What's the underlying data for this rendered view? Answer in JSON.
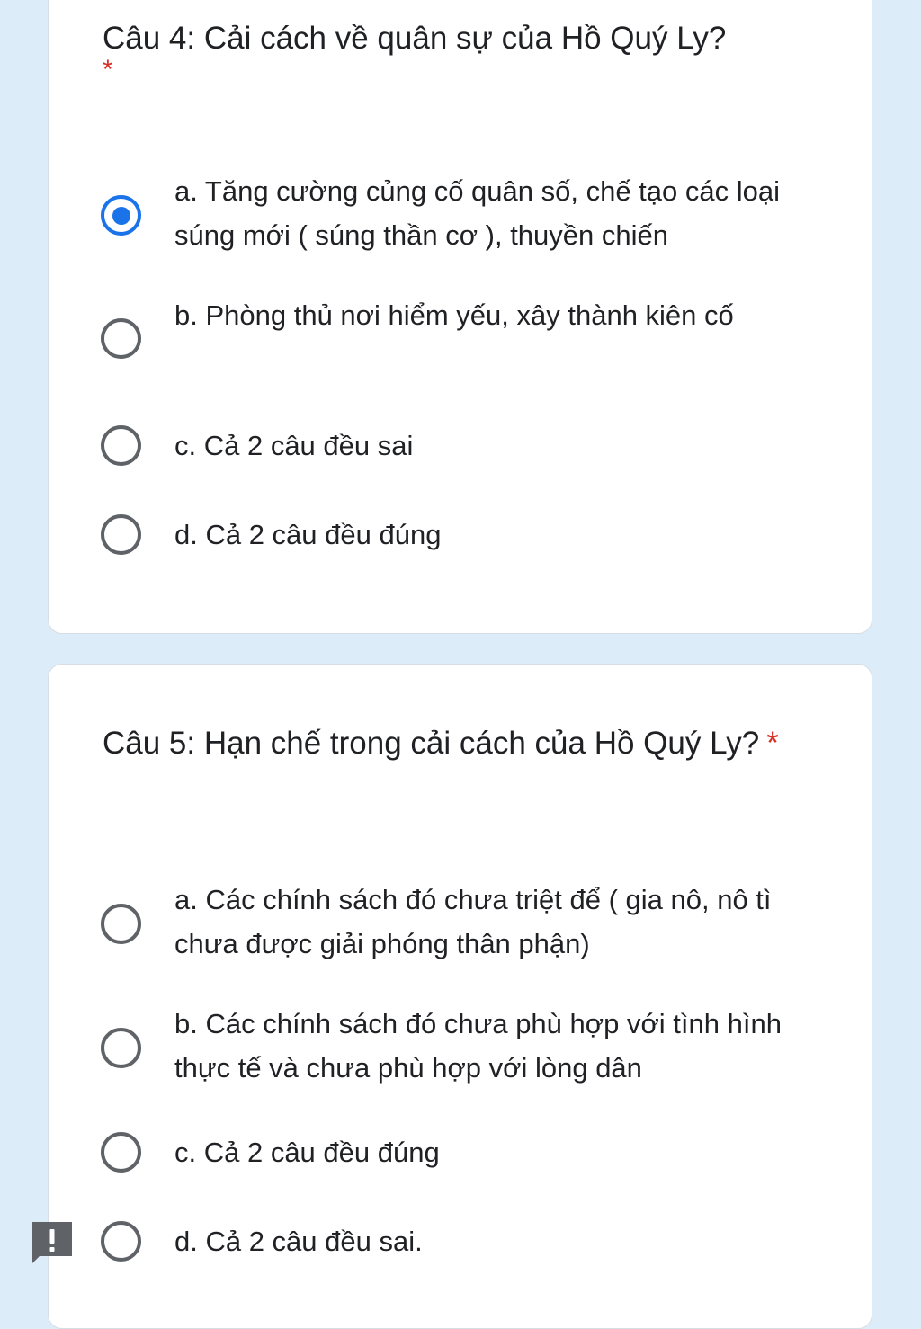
{
  "questions": [
    {
      "title": "Câu 4: Cải cách về quân sự của Hồ Quý Ly?",
      "required_mark": "*",
      "options": [
        {
          "label": "a. Tăng cường củng cố quân số, chế tạo các loại súng mới ( súng thần cơ ), thuyền chiến",
          "selected": true
        },
        {
          "label": "b. Phòng thủ nơi hiểm yếu, xây thành kiên cố",
          "selected": false
        },
        {
          "label": "c. Cả 2 câu đều sai",
          "selected": false
        },
        {
          "label": "d. Cả 2 câu đều đúng",
          "selected": false
        }
      ]
    },
    {
      "title": "Câu 5: Hạn chế trong cải cách của Hồ Quý Ly?",
      "required_mark": "*",
      "options": [
        {
          "label": "a. Các chính sách đó chưa triệt để ( gia nô, nô tì chưa được giải phóng thân phận)",
          "selected": false
        },
        {
          "label": "b. Các chính sách đó chưa phù hợp với tình hình thực tế và chưa phù hợp với lòng dân",
          "selected": false
        },
        {
          "label": "c. Cả 2 câu đều đúng",
          "selected": false
        },
        {
          "label": "d. Cả 2 câu đều sai.",
          "selected": false
        }
      ]
    }
  ],
  "feedback_icon": "report-flag-icon",
  "colors": {
    "background": "#dcedf9",
    "accent": "#1a73e8",
    "required": "#d93025",
    "radio_border": "#5f6368"
  }
}
